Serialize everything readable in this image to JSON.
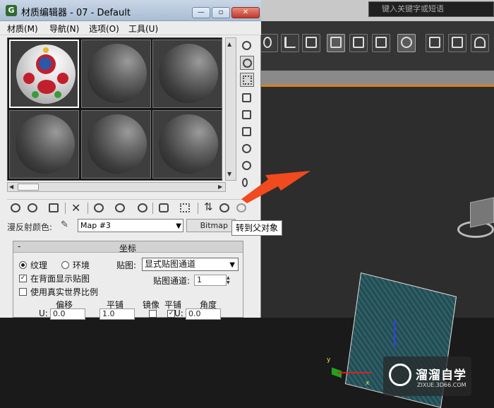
{
  "editor": {
    "title": "材质编辑器 - 07 - Default",
    "app_icon": "3ds-max-icon",
    "win_min": "—",
    "win_max": "▫",
    "win_close": "✕",
    "menus": [
      "材质(M)",
      "导航(N)",
      "选项(O)",
      "工具(U)"
    ]
  },
  "max_search": {
    "placeholder": "键入关键字或短语"
  },
  "diffuse": {
    "label": "漫反射颜色:",
    "map_value": "Map #3",
    "bitmap_label": "Bitmap"
  },
  "tooltip": "转到父对象",
  "coords": {
    "title": "坐标",
    "collapse": "-",
    "radio_texture": "纹理",
    "radio_env": "环境",
    "mapping_label": "贴图:",
    "mapping_value": "显式贴图通道",
    "backface_label": "在背面显示贴图",
    "realworld_label": "使用真实世界比例",
    "channel_label": "贴图通道:",
    "channel_value": "1",
    "col_offset": "偏移",
    "col_tiling": "平铺",
    "col_mirror": "镜像",
    "col_tile": "平铺",
    "col_angle": "角度",
    "u_label": "U:",
    "u_offset": "0.0",
    "u_tiling": "1.0",
    "u_angle": "0.0"
  },
  "watermark": {
    "text": "溜溜自学",
    "sub": "ZIXUE.3D66.COM"
  },
  "viewport": {
    "axis_y": "y",
    "axis_x": "x"
  },
  "colors": {
    "accent_orange": "#d7801c",
    "arrow_red": "#f04a1e"
  }
}
